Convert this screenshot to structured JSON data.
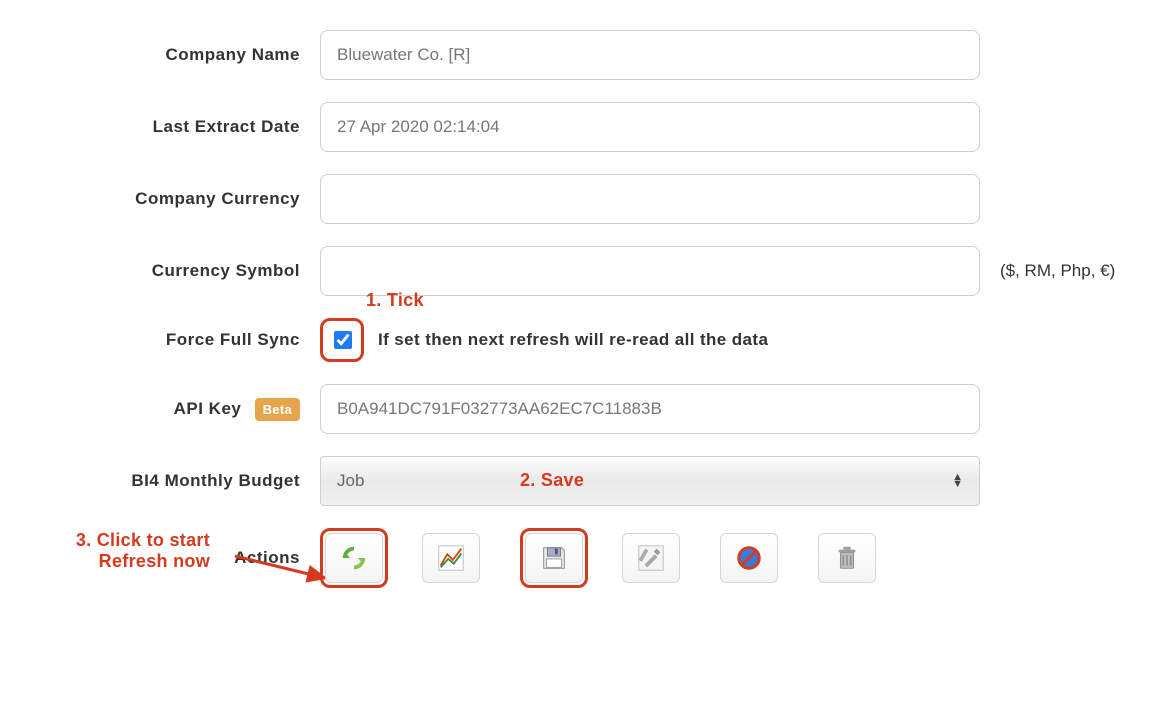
{
  "labels": {
    "company_name": "Company Name",
    "last_extract_date": "Last Extract Date",
    "company_currency": "Company Currency",
    "currency_symbol": "Currency Symbol",
    "force_full_sync": "Force Full Sync",
    "api_key": "API Key",
    "bi4_budget": "BI4 Monthly Budget",
    "actions": "Actions"
  },
  "values": {
    "company_name": "Bluewater Co. [R]",
    "last_extract_date": "27 Apr 2020 02:14:04",
    "company_currency": "",
    "currency_symbol": "",
    "api_key": "B0A941DC791F032773AA62EC7C11883B",
    "bi4_budget": "Job"
  },
  "hints": {
    "currency_symbol_suffix": "($, RM, Php, €)",
    "force_full_sync": "If set then next refresh will re-read all the data"
  },
  "badges": {
    "beta": "Beta"
  },
  "annotations": {
    "tick": "1. Tick",
    "save": "2. Save",
    "refresh_line1": "3. Click to start",
    "refresh_line2": "Refresh now"
  }
}
